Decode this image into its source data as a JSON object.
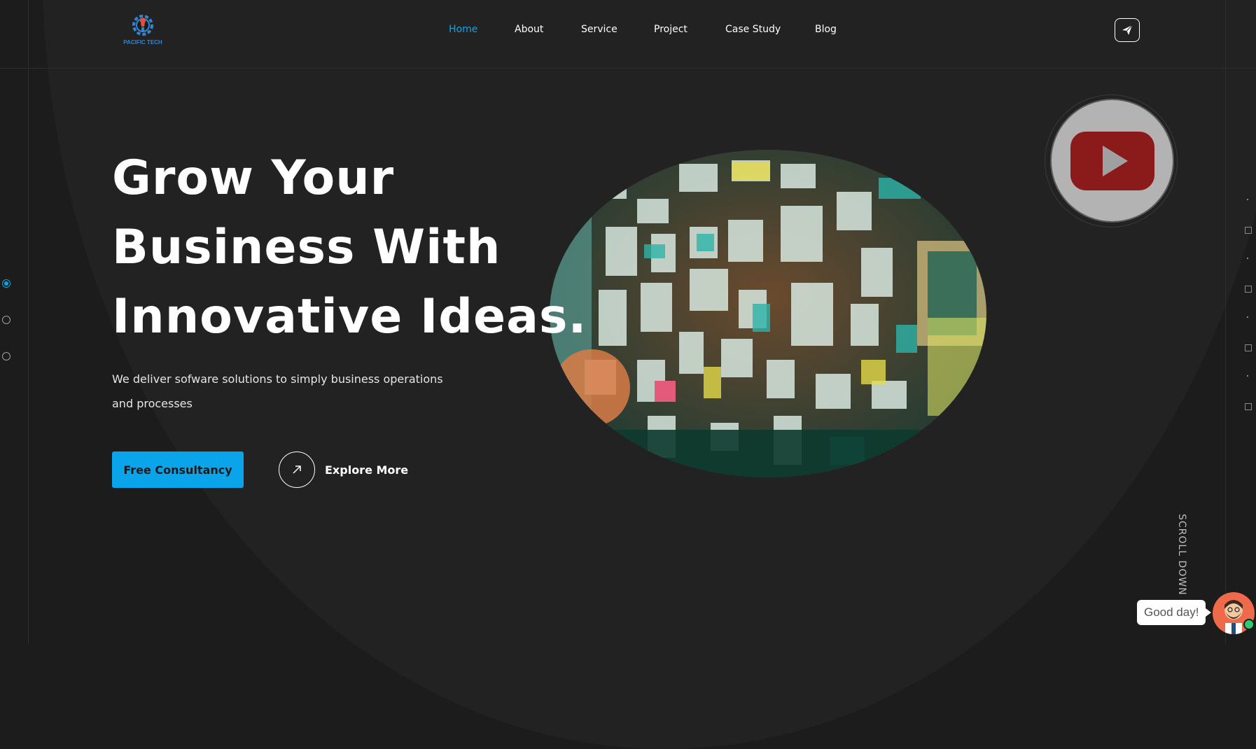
{
  "brand": {
    "name": "PACIFIC TECH"
  },
  "nav": {
    "items": [
      {
        "label": "Home",
        "active": true
      },
      {
        "label": "About"
      },
      {
        "label": "Service"
      },
      {
        "label": "Project"
      },
      {
        "label": "Case Study"
      },
      {
        "label": "Blog"
      }
    ],
    "send_icon": "paper-plane-icon"
  },
  "hero": {
    "title_lines": [
      "Grow Your",
      "Business With",
      "Innovative Ideas."
    ],
    "subtitle": "We deliver sofware solutions to simply business operations and processes",
    "primary_button": "Free Consultancy",
    "secondary_button": "Explore More",
    "image_description_icon": "wall-of-signs-photo",
    "video_icon": "youtube-play-icon"
  },
  "slider": {
    "count": 3,
    "active_index": 0
  },
  "scroll_label": "SCROLL DOWN",
  "chat": {
    "greeting": "Good day!",
    "avatar_icon": "bearded-man-avatar"
  },
  "colors": {
    "accent": "#0aa4eb",
    "background": "#1c1c1c",
    "video_red": "#8b1a1a"
  }
}
